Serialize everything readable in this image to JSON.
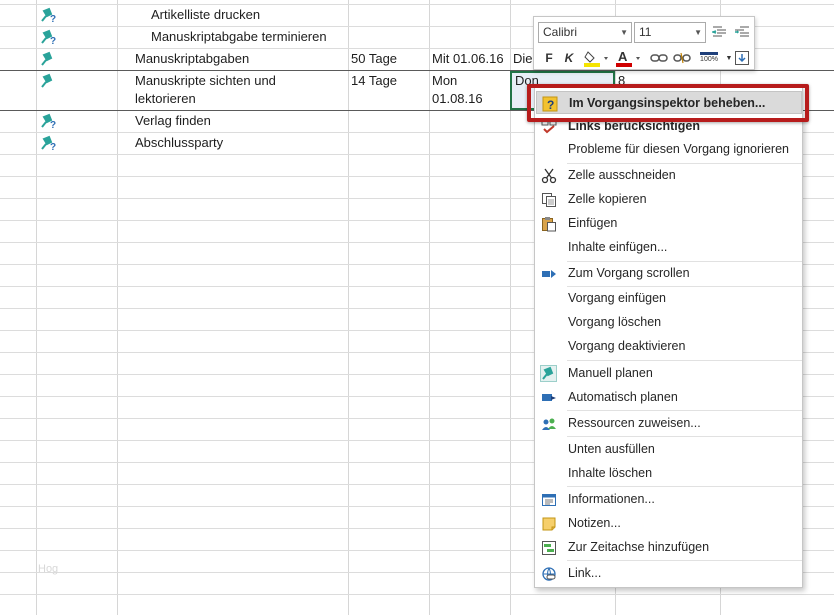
{
  "tasks": [
    {
      "name": "Artikelliste drucken",
      "pin_type": "pin-question",
      "duration": "",
      "start": "",
      "finish": "",
      "extra": ""
    },
    {
      "name": "Manuskriptabgabe terminieren",
      "pin_type": "pin-question",
      "duration": "",
      "start": "",
      "finish": "",
      "extra": ""
    },
    {
      "name": "Manuskriptabgaben",
      "pin_type": "pin",
      "duration": "50 Tage",
      "start": "Mit 01.06.16",
      "finish": "Die",
      "extra": ""
    },
    {
      "name_line1": "Manuskripte sichten und",
      "name_line2": "lektorieren",
      "pin_type": "pin",
      "duration": "14 Tage",
      "start_line1": "Mon",
      "start_line2": "01.08.16",
      "finish": "Don 18.08.16",
      "extra": "8"
    },
    {
      "name": "Verlag finden",
      "pin_type": "pin-question",
      "duration": "",
      "start": "",
      "finish": "",
      "extra": ""
    },
    {
      "name": "Abschlussparty",
      "pin_type": "pin-question",
      "duration": "",
      "start": "",
      "finish": "",
      "extra": ""
    }
  ],
  "watermark": "Hog",
  "mini_toolbar": {
    "font_name": "Calibri",
    "font_size": "11",
    "bold_label": "F",
    "italic_label": "K",
    "zoom_label": "100%",
    "accent_fill": "#f5e400",
    "accent_font": "#d00000"
  },
  "context_menu": {
    "items": [
      {
        "label": "Im Vorgangsinspektor beheben...",
        "icon": "question-icon",
        "highlighted": true
      },
      {
        "label": "Links berücksichtigen",
        "icon": "link-check-icon",
        "bold": true
      },
      {
        "label": "Probleme für diesen Vorgang ignorieren",
        "icon": ""
      },
      {
        "label": "Zelle ausschneiden",
        "icon": "scissors-icon"
      },
      {
        "label": "Zelle kopieren",
        "icon": "copy-icon"
      },
      {
        "label": "Einfügen",
        "icon": "paste-icon"
      },
      {
        "label": "Inhalte einfügen...",
        "icon": ""
      },
      {
        "label": "Zum Vorgang scrollen",
        "icon": "scroll-to-task-icon"
      },
      {
        "label": "Vorgang einfügen",
        "icon": ""
      },
      {
        "label": "Vorgang löschen",
        "icon": ""
      },
      {
        "label": "Vorgang deaktivieren",
        "icon": ""
      },
      {
        "label": "Manuell planen",
        "icon": "manual-pin-icon"
      },
      {
        "label": "Automatisch planen",
        "icon": "auto-schedule-icon"
      },
      {
        "label": "Ressourcen zuweisen...",
        "icon": "resources-icon"
      },
      {
        "label": "Unten ausfüllen",
        "icon": ""
      },
      {
        "label": "Inhalte löschen",
        "icon": ""
      },
      {
        "label": "Informationen...",
        "icon": "info-icon"
      },
      {
        "label": "Notizen...",
        "icon": "notes-icon"
      },
      {
        "label": "Zur Zeitachse hinzufügen",
        "icon": "timeline-icon"
      },
      {
        "label": "Link...",
        "icon": "hyperlink-icon"
      }
    ]
  },
  "colors": {
    "callout": "#b71c1c",
    "pin": "#2aa39a",
    "selection_border": "#217346",
    "menu_highlight": "#dadada"
  }
}
